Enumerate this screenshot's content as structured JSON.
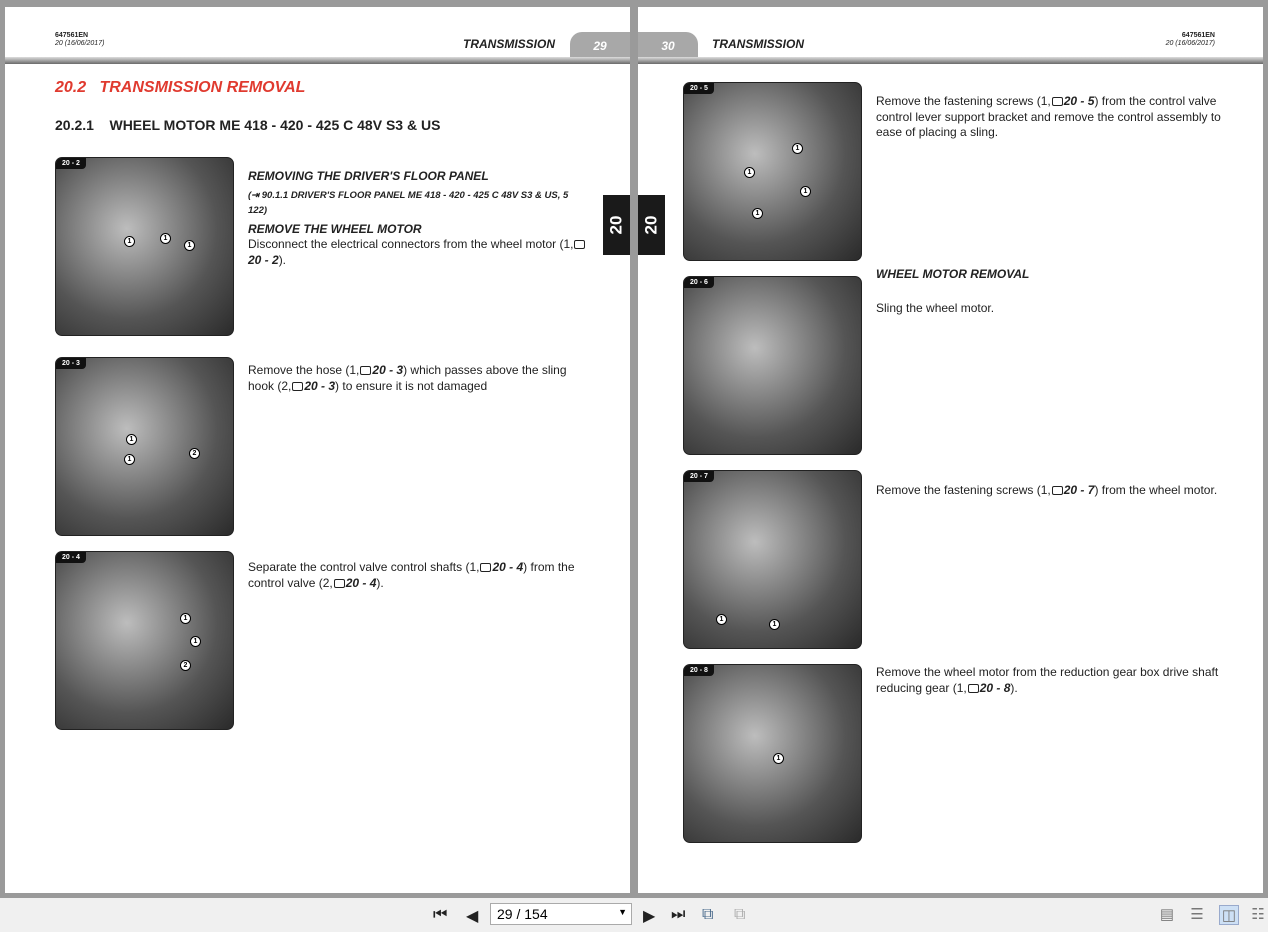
{
  "left_page": {
    "doc_id": "647561EN",
    "revision": "20 (16/06/2017)",
    "section": "TRANSMISSION",
    "page_number": "29",
    "heading": "20.2   TRANSMISSION REMOVAL",
    "subheading": "20.2.1    WHEEL MOTOR ME 418 - 420 - 425 C 48V S3 & US",
    "chapter_tab": "20",
    "steps": [
      {
        "figure": "20 - 2",
        "title": "REMOVING THE DRIVER'S FLOOR PANEL",
        "reference": "90.1.1 DRIVER'S FLOOR PANEL ME 418 - 420 - 425 C 48V S3 & US, 5 122",
        "title2": "REMOVE THE WHEEL MOTOR",
        "text_a": "Disconnect the electrical connectors from the wheel motor (1,",
        "fig_ref": "20 - 2",
        "text_b": ")."
      },
      {
        "figure": "20 - 3",
        "text_a": "Remove the hose (1,",
        "fig_ref": "20 - 3",
        "text_b": ") which passes above the sling hook (2,",
        "fig_ref2": "20 - 3",
        "text_c": ") to ensure it is not damaged"
      },
      {
        "figure": "20 - 4",
        "text_a": "Separate the control valve control shafts (1,",
        "fig_ref": "20 - 4",
        "text_b": ") from the control valve (2,",
        "fig_ref2": "20 - 4",
        "text_c": ")."
      }
    ]
  },
  "right_page": {
    "doc_id": "647561EN",
    "revision": "20 (16/06/2017)",
    "section": "TRANSMISSION",
    "page_number": "30",
    "chapter_tab": "20",
    "steps": [
      {
        "figure": "20 - 5",
        "text_a": "Remove the fastening screws (1,",
        "fig_ref": "20 - 5",
        "text_b": ") from the control valve control lever support bracket and remove the control assembly to ease of placing a sling."
      },
      {
        "figure": "20 - 6",
        "title": "WHEEL MOTOR REMOVAL",
        "text_a": "Sling the wheel motor."
      },
      {
        "figure": "20 - 7",
        "text_a": "Remove the fastening screws (1,",
        "fig_ref": "20 - 7",
        "text_b": ") from the wheel motor."
      },
      {
        "figure": "20 - 8",
        "text_a": "Remove the wheel motor from the reduction gear box drive shaft reducing gear (1,",
        "fig_ref": "20 - 8",
        "text_b": ")."
      }
    ]
  },
  "callout_1": "1",
  "callout_2": "2",
  "toolbar": {
    "page_field": "29 / 154"
  }
}
